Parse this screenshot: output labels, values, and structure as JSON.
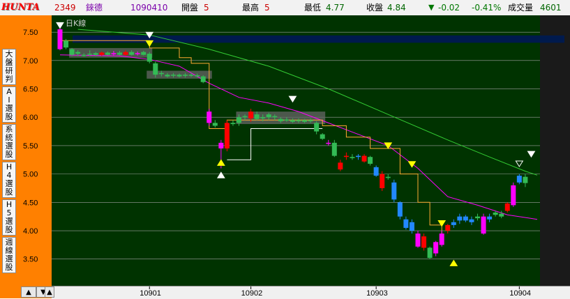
{
  "header": {
    "logo": "HUNTA",
    "symbol": "2349",
    "name": "錸德",
    "date": "1090410",
    "open_label": "開盤",
    "open_value": "5",
    "high_label": "最高",
    "high_value": "5",
    "low_label": "最低",
    "low_value": "4.77",
    "close_label": "收盤",
    "close_value": "4.84",
    "change": "-0.02",
    "change_pct": "-0.41%",
    "volume_label": "成交量",
    "volume_value": "4601"
  },
  "sidebar": {
    "tabs": [
      {
        "label": "大盤研判"
      },
      {
        "label": "AI選股"
      },
      {
        "label": "系統選股"
      },
      {
        "label": "H4選股"
      },
      {
        "label": "H5選股"
      },
      {
        "label": "週線選股"
      }
    ]
  },
  "colors": {
    "background": "#003300",
    "up_candle": "#ff0000",
    "down_candle": "#33bb55",
    "ma_short": "#ff00ff",
    "ma_long": "#33cc33",
    "stop_line": "#ffaa33",
    "support_line": "#ffffff",
    "accent": "#ff8000"
  },
  "chart_data": {
    "type": "candlestick",
    "title": "日K線",
    "ylim": [
      3.3,
      7.6
    ],
    "y_ticks": [
      "7.50",
      "7.00",
      "6.50",
      "6.00",
      "5.50",
      "5.00",
      "4.50",
      "4.00",
      "3.50"
    ],
    "x_ticks": [
      {
        "label": "10901",
        "index": 15
      },
      {
        "label": "10902",
        "index": 32
      },
      {
        "label": "10903",
        "index": 53
      },
      {
        "label": "10904",
        "index": 77
      }
    ],
    "candles": [
      {
        "o": 7.55,
        "h": 7.6,
        "l": 7.18,
        "c": 7.2,
        "k": "m"
      },
      {
        "o": 7.35,
        "h": 7.38,
        "l": 7.2,
        "c": 7.23,
        "k": "g"
      },
      {
        "o": 7.2,
        "h": 7.22,
        "l": 7.08,
        "c": 7.1,
        "k": "g"
      },
      {
        "o": 7.15,
        "h": 7.18,
        "l": 7.08,
        "c": 7.12,
        "k": "g"
      },
      {
        "o": 7.1,
        "h": 7.13,
        "l": 7.07,
        "c": 7.1,
        "k": "g"
      },
      {
        "o": 7.12,
        "h": 7.18,
        "l": 7.08,
        "c": 7.12,
        "k": "g"
      },
      {
        "o": 7.1,
        "h": 7.15,
        "l": 7.08,
        "c": 7.13,
        "k": "g"
      },
      {
        "o": 7.1,
        "h": 7.16,
        "l": 7.08,
        "c": 7.14,
        "k": "r"
      },
      {
        "o": 7.14,
        "h": 7.16,
        "l": 7.09,
        "c": 7.1,
        "k": "g"
      },
      {
        "o": 7.11,
        "h": 7.17,
        "l": 7.09,
        "c": 7.13,
        "k": "m"
      },
      {
        "o": 7.14,
        "h": 7.17,
        "l": 7.09,
        "c": 7.1,
        "k": "g"
      },
      {
        "o": 7.1,
        "h": 7.18,
        "l": 7.08,
        "c": 7.15,
        "k": "r"
      },
      {
        "o": 7.15,
        "h": 7.18,
        "l": 7.09,
        "c": 7.1,
        "k": "g"
      },
      {
        "o": 7.12,
        "h": 7.16,
        "l": 7.09,
        "c": 7.13,
        "k": "m"
      },
      {
        "o": 7.1,
        "h": 7.17,
        "l": 7.09,
        "c": 7.15,
        "k": "g"
      },
      {
        "o": 7.12,
        "h": 7.15,
        "l": 6.95,
        "c": 6.98,
        "k": "g"
      },
      {
        "o": 6.95,
        "h": 6.98,
        "l": 6.7,
        "c": 6.75,
        "k": "g"
      },
      {
        "o": 6.78,
        "h": 6.82,
        "l": 6.72,
        "c": 6.76,
        "k": "g"
      },
      {
        "o": 6.75,
        "h": 6.78,
        "l": 6.7,
        "c": 6.72,
        "k": "g"
      },
      {
        "o": 6.74,
        "h": 6.78,
        "l": 6.7,
        "c": 6.75,
        "k": "g"
      },
      {
        "o": 6.72,
        "h": 6.77,
        "l": 6.7,
        "c": 6.75,
        "k": "g"
      },
      {
        "o": 6.73,
        "h": 6.78,
        "l": 6.7,
        "c": 6.75,
        "k": "g"
      },
      {
        "o": 6.75,
        "h": 6.78,
        "l": 6.71,
        "c": 6.73,
        "k": "g"
      },
      {
        "o": 6.74,
        "h": 6.77,
        "l": 6.7,
        "c": 6.72,
        "k": "g"
      },
      {
        "o": 6.72,
        "h": 6.74,
        "l": 6.6,
        "c": 6.62,
        "k": "g"
      },
      {
        "o": 6.1,
        "h": 6.15,
        "l": 5.85,
        "c": 5.9,
        "k": "m"
      },
      {
        "o": 5.9,
        "h": 5.95,
        "l": 5.82,
        "c": 5.85,
        "k": "g"
      },
      {
        "o": 5.55,
        "h": 5.6,
        "l": 5.1,
        "c": 5.45,
        "k": "m"
      },
      {
        "o": 5.45,
        "h": 5.95,
        "l": 5.4,
        "c": 5.9,
        "k": "r"
      },
      {
        "o": 5.9,
        "h": 5.95,
        "l": 5.85,
        "c": 5.88,
        "k": "g"
      },
      {
        "o": 5.9,
        "h": 6.05,
        "l": 5.85,
        "c": 6.0,
        "k": "g"
      },
      {
        "o": 6.0,
        "h": 6.05,
        "l": 5.95,
        "c": 6.02,
        "k": "g"
      },
      {
        "o": 5.98,
        "h": 6.15,
        "l": 5.92,
        "c": 6.1,
        "k": "r"
      },
      {
        "o": 6.05,
        "h": 6.1,
        "l": 5.95,
        "c": 5.97,
        "k": "g"
      },
      {
        "o": 5.98,
        "h": 6.05,
        "l": 5.93,
        "c": 6.0,
        "k": "g"
      },
      {
        "o": 6.0,
        "h": 6.08,
        "l": 5.95,
        "c": 6.05,
        "k": "g"
      },
      {
        "o": 6.0,
        "h": 6.05,
        "l": 5.95,
        "c": 6.02,
        "k": "g"
      },
      {
        "o": 5.97,
        "h": 6.0,
        "l": 5.9,
        "c": 5.93,
        "k": "g"
      },
      {
        "o": 5.95,
        "h": 6.0,
        "l": 5.92,
        "c": 5.96,
        "k": "g"
      },
      {
        "o": 5.95,
        "h": 5.98,
        "l": 5.9,
        "c": 5.92,
        "k": "g"
      },
      {
        "o": 5.93,
        "h": 5.98,
        "l": 5.9,
        "c": 5.95,
        "k": "g"
      },
      {
        "o": 5.92,
        "h": 5.97,
        "l": 5.9,
        "c": 5.95,
        "k": "g"
      },
      {
        "o": 5.95,
        "h": 5.98,
        "l": 5.9,
        "c": 5.93,
        "k": "g"
      },
      {
        "o": 5.9,
        "h": 5.93,
        "l": 5.7,
        "c": 5.75,
        "k": "g"
      },
      {
        "o": 5.7,
        "h": 5.72,
        "l": 5.6,
        "c": 5.62,
        "k": "g"
      },
      {
        "o": 5.55,
        "h": 5.6,
        "l": 5.5,
        "c": 5.55,
        "k": "m"
      },
      {
        "o": 5.55,
        "h": 5.6,
        "l": 5.3,
        "c": 5.32,
        "k": "g"
      },
      {
        "o": 5.2,
        "h": 5.25,
        "l": 5.05,
        "c": 5.08,
        "k": "r"
      },
      {
        "o": 5.3,
        "h": 5.38,
        "l": 5.25,
        "c": 5.32,
        "k": "r"
      },
      {
        "o": 5.3,
        "h": 5.35,
        "l": 5.25,
        "c": 5.28,
        "k": "g"
      },
      {
        "o": 5.3,
        "h": 5.35,
        "l": 5.25,
        "c": 5.32,
        "k": "b"
      },
      {
        "o": 5.22,
        "h": 5.35,
        "l": 5.2,
        "c": 5.32,
        "k": "r"
      },
      {
        "o": 5.3,
        "h": 5.32,
        "l": 5.15,
        "c": 5.18,
        "k": "g"
      },
      {
        "o": 5.12,
        "h": 5.15,
        "l": 4.95,
        "c": 4.97,
        "k": "b"
      },
      {
        "o": 4.75,
        "h": 5.05,
        "l": 4.7,
        "c": 5.0,
        "k": "r"
      },
      {
        "o": 4.95,
        "h": 5.0,
        "l": 4.9,
        "c": 4.93,
        "k": "g"
      },
      {
        "o": 4.85,
        "h": 4.9,
        "l": 4.5,
        "c": 4.55,
        "k": "b"
      },
      {
        "o": 4.5,
        "h": 4.52,
        "l": 4.2,
        "c": 4.25,
        "k": "b"
      },
      {
        "o": 4.2,
        "h": 4.25,
        "l": 4.02,
        "c": 4.05,
        "k": "b"
      },
      {
        "o": 4.15,
        "h": 4.2,
        "l": 3.95,
        "c": 4.0,
        "k": "b"
      },
      {
        "o": 3.95,
        "h": 4.0,
        "l": 3.7,
        "c": 3.72,
        "k": "m"
      },
      {
        "o": 3.9,
        "h": 3.95,
        "l": 3.65,
        "c": 3.7,
        "k": "r"
      },
      {
        "o": 3.7,
        "h": 3.72,
        "l": 3.5,
        "c": 3.52,
        "k": "g"
      },
      {
        "o": 3.6,
        "h": 3.82,
        "l": 3.55,
        "c": 3.8,
        "k": "m"
      },
      {
        "o": 3.75,
        "h": 4.0,
        "l": 3.72,
        "c": 3.95,
        "k": "m"
      },
      {
        "o": 4.0,
        "h": 4.12,
        "l": 3.95,
        "c": 4.1,
        "k": "r"
      },
      {
        "o": 4.1,
        "h": 4.2,
        "l": 4.05,
        "c": 4.15,
        "k": "b"
      },
      {
        "o": 4.18,
        "h": 4.3,
        "l": 4.12,
        "c": 4.25,
        "k": "b"
      },
      {
        "o": 4.25,
        "h": 4.28,
        "l": 4.15,
        "c": 4.18,
        "k": "b"
      },
      {
        "o": 4.2,
        "h": 4.25,
        "l": 4.1,
        "c": 4.15,
        "k": "b"
      },
      {
        "o": 4.25,
        "h": 4.3,
        "l": 4.18,
        "c": 4.22,
        "k": "g"
      },
      {
        "o": 3.95,
        "h": 4.3,
        "l": 3.93,
        "c": 4.25,
        "k": "m"
      },
      {
        "o": 4.25,
        "h": 4.3,
        "l": 4.15,
        "c": 4.2,
        "k": "b"
      },
      {
        "o": 4.28,
        "h": 4.35,
        "l": 4.25,
        "c": 4.32,
        "k": "g"
      },
      {
        "o": 4.3,
        "h": 4.35,
        "l": 4.22,
        "c": 4.25,
        "k": "g"
      },
      {
        "o": 4.35,
        "h": 4.5,
        "l": 4.32,
        "c": 4.48,
        "k": "r"
      },
      {
        "o": 4.45,
        "h": 4.85,
        "l": 4.42,
        "c": 4.8,
        "k": "m"
      },
      {
        "o": 4.85,
        "h": 5.0,
        "l": 4.82,
        "c": 4.97,
        "k": "b"
      },
      {
        "o": 4.95,
        "h": 5.0,
        "l": 4.77,
        "c": 4.84,
        "k": "g"
      }
    ],
    "ma_short": [
      [
        0,
        7.1
      ],
      [
        10,
        7.08
      ],
      [
        15,
        7.02
      ],
      [
        20,
        6.9
      ],
      [
        25,
        6.6
      ],
      [
        30,
        6.35
      ],
      [
        35,
        6.25
      ],
      [
        40,
        6.1
      ],
      [
        45,
        5.9
      ],
      [
        50,
        5.7
      ],
      [
        55,
        5.5
      ],
      [
        60,
        5.1
      ],
      [
        65,
        4.6
      ],
      [
        70,
        4.45
      ],
      [
        75,
        4.28
      ],
      [
        80,
        4.2
      ]
    ],
    "ma_long": [
      [
        3,
        7.55
      ],
      [
        15,
        7.45
      ],
      [
        25,
        7.2
      ],
      [
        35,
        6.9
      ],
      [
        45,
        6.5
      ],
      [
        55,
        6.05
      ],
      [
        65,
        5.6
      ],
      [
        72,
        5.3
      ],
      [
        78,
        5.05
      ],
      [
        80,
        4.98
      ]
    ],
    "stop_line": [
      [
        0,
        7.35
      ],
      [
        15,
        7.35
      ],
      [
        15,
        7.22
      ],
      [
        20,
        7.22
      ],
      [
        20,
        7.05
      ],
      [
        22,
        7.05
      ],
      [
        22,
        6.95
      ],
      [
        25,
        6.95
      ],
      [
        25,
        6.65
      ],
      [
        25,
        5.8
      ],
      [
        28,
        5.8
      ],
      [
        28,
        5.95
      ],
      [
        44,
        5.95
      ],
      [
        44,
        5.85
      ],
      [
        48,
        5.85
      ],
      [
        48,
        5.65
      ],
      [
        52,
        5.65
      ],
      [
        52,
        5.45
      ],
      [
        57,
        5.45
      ],
      [
        57,
        5.0
      ],
      [
        60,
        5.0
      ],
      [
        60,
        4.5
      ],
      [
        62,
        4.5
      ],
      [
        62,
        4.1
      ],
      [
        64,
        4.1
      ],
      [
        64,
        3.8
      ]
    ],
    "support_line": [
      [
        28,
        5.25
      ],
      [
        32,
        5.25
      ],
      [
        32,
        5.8
      ],
      [
        44,
        5.8
      ]
    ],
    "boxes": [
      {
        "i0": 2,
        "i1": 15,
        "p0": 7.05,
        "p1": 7.22
      },
      {
        "i0": 15,
        "i1": 25,
        "p0": 6.68,
        "p1": 6.82
      },
      {
        "i0": 30,
        "i1": 44,
        "p0": 5.88,
        "p1": 6.1
      }
    ],
    "signals": [
      {
        "i": 0,
        "p": 7.62,
        "t": "sell_hollow"
      },
      {
        "i": 15,
        "p": 7.45,
        "t": "sell_hollow"
      },
      {
        "i": 15,
        "p": 7.3,
        "t": "sell_yellow"
      },
      {
        "i": 39,
        "p": 6.32,
        "t": "sell_hollow"
      },
      {
        "i": 55,
        "p": 5.5,
        "t": "sell_yellow"
      },
      {
        "i": 59,
        "p": 5.17,
        "t": "sell_yellow"
      },
      {
        "i": 64,
        "p": 4.13,
        "t": "sell_yellow"
      },
      {
        "i": 79,
        "p": 5.35,
        "t": "sell_hollow"
      },
      {
        "i": 77,
        "p": 5.18,
        "t": "sell_open"
      },
      {
        "i": 27,
        "p": 5.2,
        "t": "buy_yellow"
      },
      {
        "i": 27,
        "p": 4.98,
        "t": "buy_white"
      },
      {
        "i": 66,
        "p": 3.43,
        "t": "buy_yellow"
      }
    ],
    "overlay_band": {
      "p0": 7.35,
      "p1": 7.43
    }
  }
}
